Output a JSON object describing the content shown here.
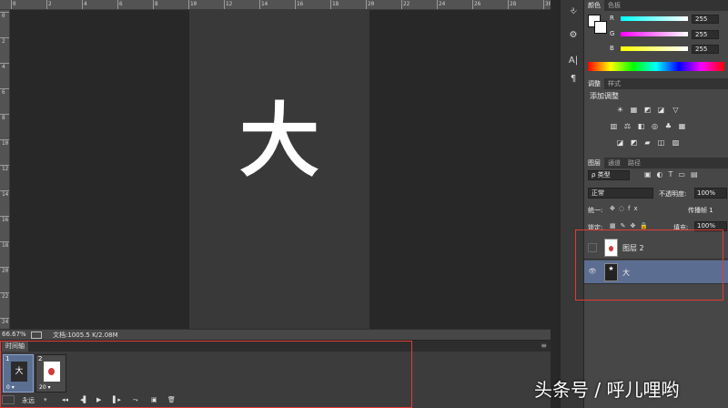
{
  "rulers": {
    "top_labels": [
      "0",
      "2",
      "4",
      "6",
      "8",
      "10",
      "12",
      "14",
      "16",
      "18",
      "20",
      "22",
      "24",
      "26",
      "28",
      "30"
    ],
    "left_labels": [
      "0",
      "2",
      "4",
      "6",
      "8",
      "10",
      "12",
      "14",
      "16",
      "18",
      "20",
      "22",
      "24"
    ]
  },
  "canvas": {
    "text": "大"
  },
  "status": {
    "zoom": "66.67%",
    "doc_info": "文档:1005.5 K/2.08M"
  },
  "timeline": {
    "tab": "时间轴",
    "menu_icon": "≡",
    "frames": [
      {
        "num": "1",
        "thumb_text": "大",
        "delay": "0 ▾"
      },
      {
        "num": "2",
        "thumb_text": "",
        "delay": "20 ▾"
      }
    ],
    "loop": "永远",
    "controls": [
      "◂◂",
      "◂▌",
      "▶",
      "▌▸",
      "⤳",
      "▣",
      "🗑"
    ]
  },
  "dock": {
    "icons": [
      "⎀",
      "⚙",
      "A|",
      "¶"
    ]
  },
  "color_panel": {
    "tabs": [
      "颜色",
      "色板"
    ],
    "channels": [
      {
        "label": "R",
        "value": "255"
      },
      {
        "label": "G",
        "value": "255"
      },
      {
        "label": "B",
        "value": "255"
      }
    ]
  },
  "adjust_panel": {
    "tabs": [
      "调整",
      "样式"
    ],
    "title": "添加调整",
    "row1": [
      "☀",
      "▦",
      "◩",
      "◪",
      "▽"
    ],
    "row2": [
      "▥",
      "⚖",
      "◧",
      "◎",
      "♣",
      "▦"
    ],
    "row3": [
      "◪",
      "◩",
      "▰",
      "◫",
      "▨"
    ]
  },
  "layers_panel": {
    "tabs": [
      "图层",
      "通道",
      "路径"
    ],
    "filter": "ρ 类型",
    "blend_mode": "正常",
    "opacity_label": "不透明度:",
    "opacity_value": "100%",
    "unify_label": "统一:",
    "propagate_label": "传播帧 1",
    "lock_label": "锁定:",
    "fill_label": "填充:",
    "fill_value": "100%",
    "layers": [
      {
        "name": "图层 2",
        "visible": false
      },
      {
        "name": "大",
        "visible": true,
        "selected": true
      }
    ]
  },
  "watermark": "头条号 / 呼儿哩哟"
}
